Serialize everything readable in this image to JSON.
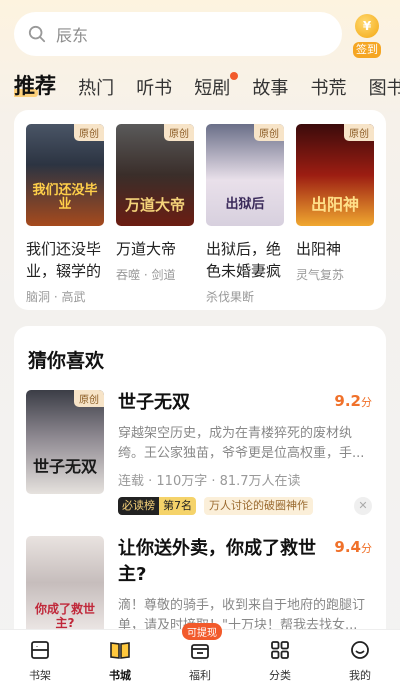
{
  "search": {
    "placeholder": "辰东"
  },
  "checkin": {
    "coin": "¥",
    "label": "签到"
  },
  "tabs": [
    {
      "label": "推荐",
      "active": true
    },
    {
      "label": "热门"
    },
    {
      "label": "听书"
    },
    {
      "label": "短剧",
      "dot": true
    },
    {
      "label": "故事"
    },
    {
      "label": "书荒"
    },
    {
      "label": "图书"
    }
  ],
  "top_books": [
    {
      "cover_tag": "原创",
      "cover_text": "我们还没毕业",
      "title": "我们还没毕业，辍学的",
      "meta": "脑洞 · 高武"
    },
    {
      "cover_tag": "原创",
      "cover_text": "万道大帝",
      "title": "万道大帝",
      "meta": "吞噬 · 剑道"
    },
    {
      "cover_tag": "原创",
      "cover_text": "出狱后",
      "title": "出狱后，绝色未婚妻疯",
      "meta": "杀伐果断"
    },
    {
      "cover_tag": "原创",
      "cover_text": "出阳神",
      "title": "出阳神",
      "meta": "灵气复苏"
    }
  ],
  "recommend": {
    "title": "猜你喜欢",
    "items": [
      {
        "cover_tag": "原创",
        "cover_text": "世子无双",
        "title": "世子无双",
        "score": "9.2",
        "score_unit": "分",
        "desc": "穿越架空历史，成为在青楼猝死的废材纨绔。王公家独苗，爷爷更是位高权重，手...",
        "stats": "连载 · 110万字 · 81.7万人在读",
        "rank_label": "必读榜",
        "rank_pos": "第7名",
        "topic": "万人讨论的破圈神作",
        "dismiss": "✕"
      },
      {
        "cover_tag": "",
        "cover_text": "你成了救世主?",
        "title": "让你送外卖，你成了救世主?",
        "score": "9.4",
        "score_unit": "分",
        "desc": "滴！尊敬的骑手，收到来自于地府的跑腿订单，请及时接取！\"十万块！帮我去找女..."
      }
    ]
  },
  "bottom_nav": [
    {
      "label": "书架",
      "icon": "bookshelf-icon"
    },
    {
      "label": "书城",
      "icon": "book-store-icon",
      "active": true
    },
    {
      "label": "福利",
      "icon": "welfare-icon",
      "badge": "可提现"
    },
    {
      "label": "分类",
      "icon": "category-icon"
    },
    {
      "label": "我的",
      "icon": "profile-icon"
    }
  ]
}
